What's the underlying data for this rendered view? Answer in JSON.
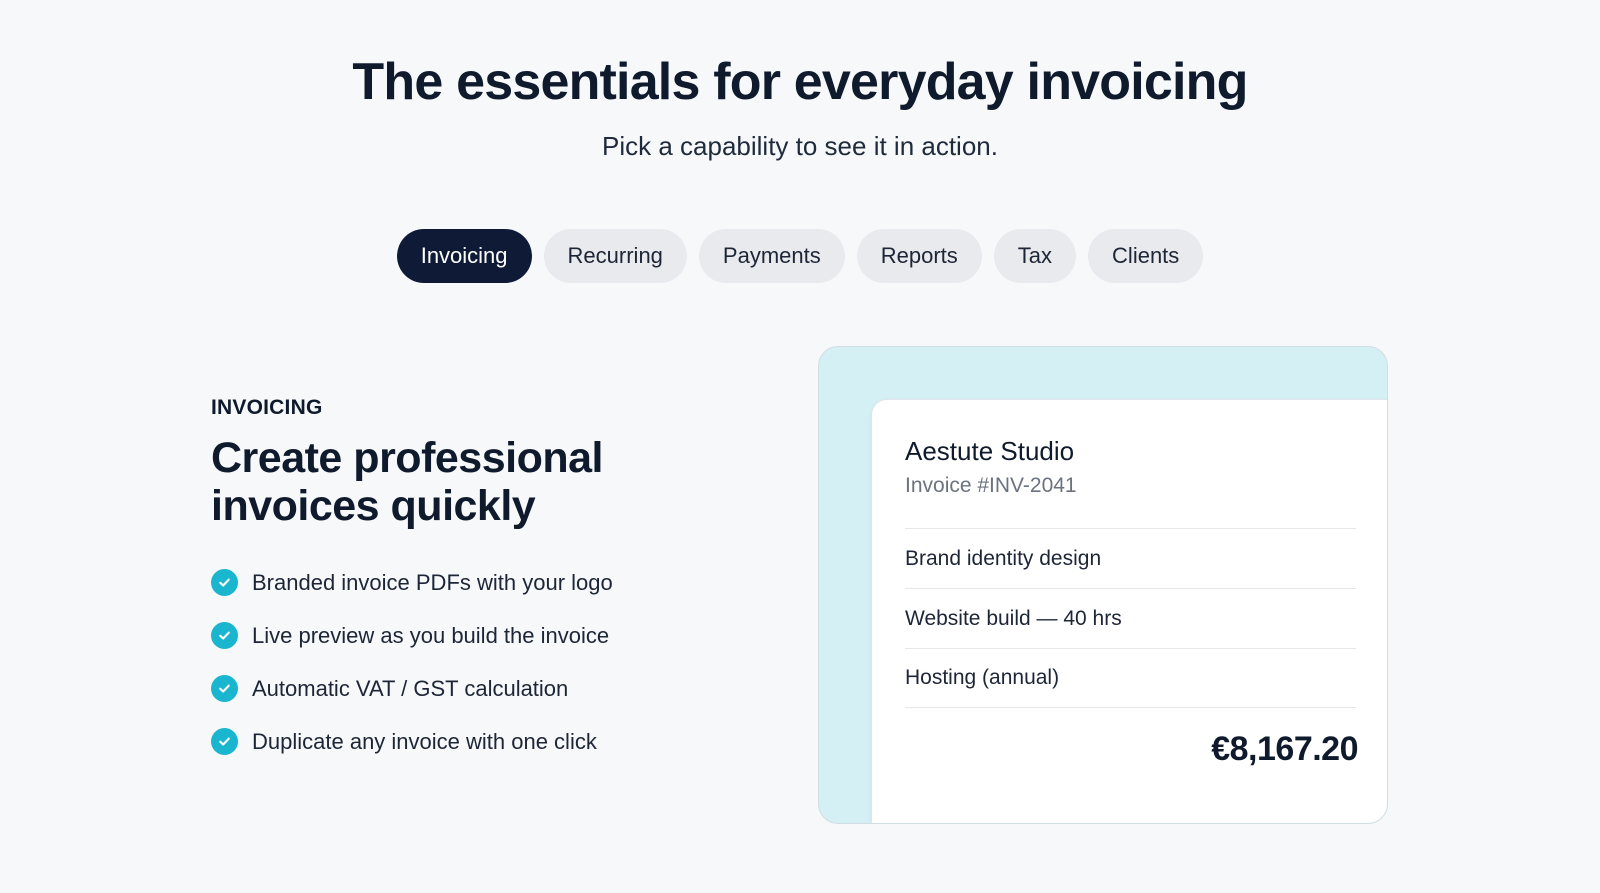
{
  "header": {
    "title": "The essentials for everyday invoicing",
    "subtitle": "Pick a capability to see it in action."
  },
  "tabs": [
    {
      "label": "Invoicing",
      "active": true
    },
    {
      "label": "Recurring",
      "active": false
    },
    {
      "label": "Payments",
      "active": false
    },
    {
      "label": "Reports",
      "active": false
    },
    {
      "label": "Tax",
      "active": false
    },
    {
      "label": "Clients",
      "active": false
    }
  ],
  "feature": {
    "eyebrow": "INVOICING",
    "headline_line1": "Create professional",
    "headline_line2": "invoices quickly",
    "bullets": [
      {
        "text": "Branded invoice PDFs with your logo",
        "icon": "check-circle-icon"
      },
      {
        "text": "Live preview as you build the invoice",
        "icon": "check-circle-icon"
      },
      {
        "text": "Automatic VAT / GST calculation",
        "icon": "check-circle-icon"
      },
      {
        "text": "Duplicate any invoice with one click",
        "icon": "check-circle-icon"
      }
    ]
  },
  "invoice_preview": {
    "client": "Aestute Studio",
    "invoice_number": "Invoice #INV-2041",
    "line_items": [
      "Brand identity design",
      "Website build — 40 hrs",
      "Hosting (annual)"
    ],
    "total": "€8,167.20"
  },
  "colors": {
    "background": "#f6f8fa",
    "active_tab": "#0f1b36",
    "inactive_tab": "#e8eaed",
    "accent_check": "#1ab6cf",
    "preview_panel": "#d5f0f4",
    "text_primary": "#0f1b2d"
  }
}
